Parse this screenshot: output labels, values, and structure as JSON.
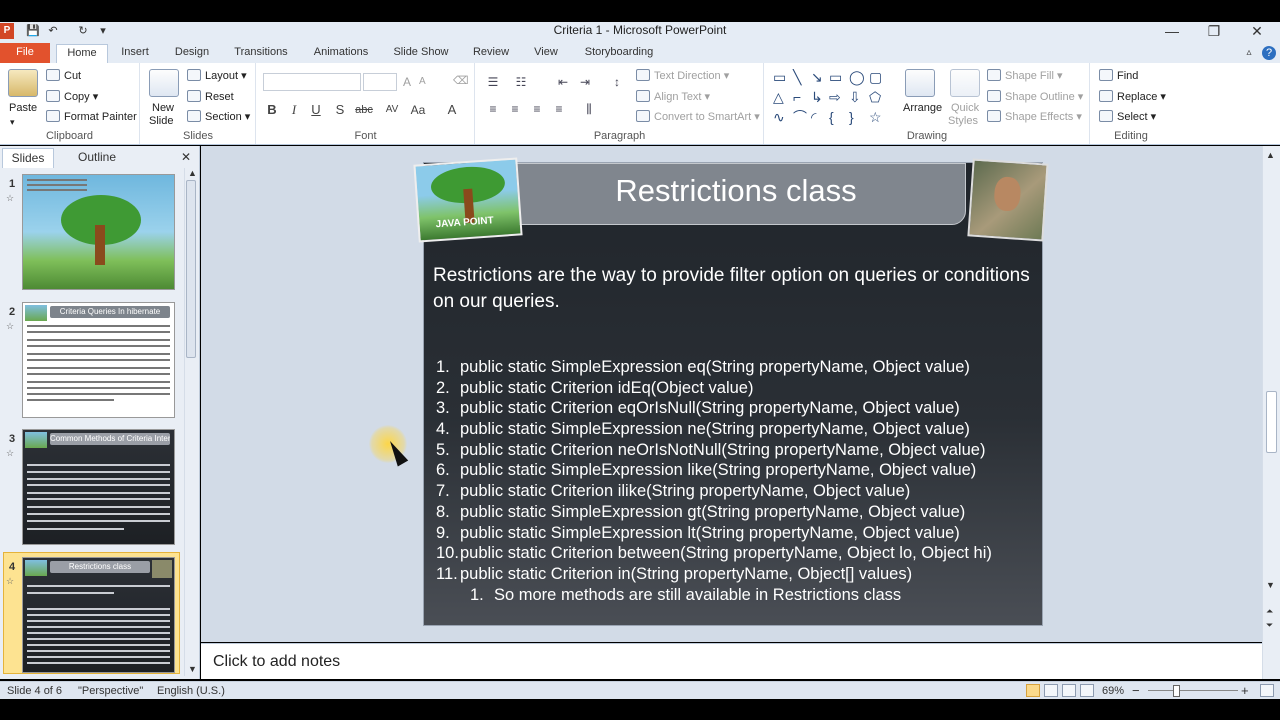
{
  "window": {
    "title": "Criteria 1 - Microsoft PowerPoint",
    "app_icon": "P",
    "minimize": "—",
    "restore": "❐",
    "close": "✕"
  },
  "quick_access": {
    "save": "💾",
    "undo": "↶",
    "redo": "↻",
    "customize": "▾"
  },
  "tabs": {
    "file": "File",
    "home": "Home",
    "insert": "Insert",
    "design": "Design",
    "transitions": "Transitions",
    "animations": "Animations",
    "slide_show": "Slide Show",
    "review": "Review",
    "view": "View",
    "storyboarding": "Storyboarding"
  },
  "ribbon": {
    "clipboard": {
      "label": "Clipboard",
      "paste": "Paste",
      "cut": "Cut",
      "copy": "Copy",
      "format_painter": "Format Painter"
    },
    "slides": {
      "label": "Slides",
      "new_slide": "New",
      "new_slide_2": "Slide",
      "layout": "Layout",
      "reset": "Reset",
      "section": "Section"
    },
    "font": {
      "label": "Font",
      "bold": "B",
      "italic": "I",
      "underline": "U",
      "strike": "S",
      "abc": "abc",
      "spacing": "AV",
      "case": "Aa",
      "color": "A"
    },
    "paragraph": {
      "label": "Paragraph",
      "text_direction": "Text Direction",
      "align_text": "Align Text",
      "convert_smartart": "Convert to SmartArt"
    },
    "drawing": {
      "label": "Drawing",
      "arrange": "Arrange",
      "quick_styles": "Quick",
      "quick_styles_2": "Styles",
      "shape_fill": "Shape Fill",
      "shape_outline": "Shape Outline",
      "shape_effects": "Shape Effects"
    },
    "editing": {
      "label": "Editing",
      "find": "Find",
      "replace": "Replace",
      "select": "Select"
    }
  },
  "left_panel": {
    "tab_slides": "Slides",
    "tab_outline": "Outline",
    "close": "✕",
    "thumbnails": [
      {
        "num": "1",
        "title": ""
      },
      {
        "num": "2",
        "title": "Criteria Queries In hibernate"
      },
      {
        "num": "3",
        "title": "Common Methods of Criteria Interface"
      },
      {
        "num": "4",
        "title": "Restrictions class"
      }
    ]
  },
  "slide": {
    "title": "Restrictions class",
    "logo_text": "JAVA POINT",
    "intro": "Restrictions are the way to provide filter option on queries or conditions on our queries.",
    "items": [
      {
        "n": "1.",
        "text": "public static SimpleExpression  eq(String propertyName,  Object value)"
      },
      {
        "n": "2.",
        "text": "public static Criterion idEq(Object value)"
      },
      {
        "n": "3.",
        "text": "public static Criterion eqOrIsNull(String  propertyName,  Object value)"
      },
      {
        "n": "4.",
        "text": "public static SimpleExpression  ne(String propertyName,  Object value)"
      },
      {
        "n": "5.",
        "text": "public static Criterion neOrIsNotNull(String  propertyName,  Object value)"
      },
      {
        "n": "6.",
        "text": "public static SimpleExpression  like(String propertyName,  Object value)"
      },
      {
        "n": "7.",
        "text": "public static Criterion ilike(String propertyName,  Object value)"
      },
      {
        "n": "8.",
        "text": "public static SimpleExpression  gt(String propertyName,  Object value)"
      },
      {
        "n": "9.",
        "text": "public static SimpleExpression  lt(String propertyName,  Object value)"
      },
      {
        "n": "10.",
        "text": "public static Criterion between(String  propertyName,  Object lo,  Object hi)"
      },
      {
        "n": "11.",
        "text": "public static Criterion in(String  propertyName,  Object[] values)"
      }
    ],
    "sub_item": {
      "n": "1.",
      "text": "So more methods are still available in Restrictions class"
    }
  },
  "notes": {
    "placeholder": "Click to add notes"
  },
  "status": {
    "slide": "Slide 4 of 6",
    "theme": "\"Perspective\"",
    "language": "English (U.S.)",
    "zoom": "69%",
    "zoom_out": "−",
    "zoom_in": "+"
  }
}
